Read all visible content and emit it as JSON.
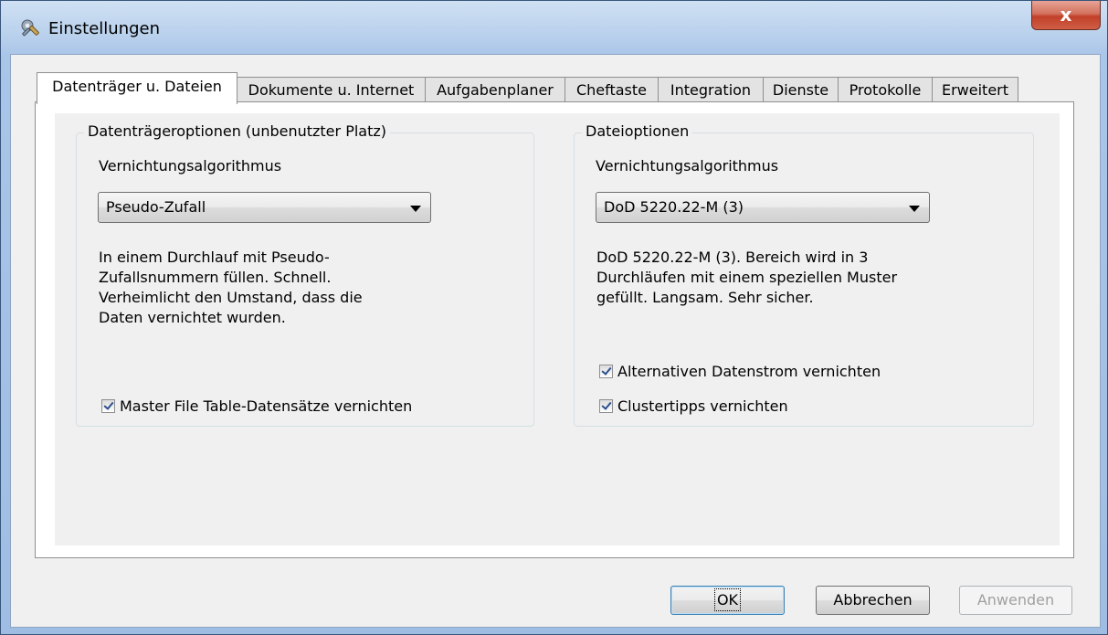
{
  "window": {
    "title": "Einstellungen",
    "close_label": "x"
  },
  "tabs": [
    {
      "label": "Datenträger u. Dateien"
    },
    {
      "label": "Dokumente u. Internet"
    },
    {
      "label": "Aufgabenplaner"
    },
    {
      "label": "Cheftaste"
    },
    {
      "label": "Integration"
    },
    {
      "label": "Dienste"
    },
    {
      "label": "Protokolle"
    },
    {
      "label": "Erweitert"
    }
  ],
  "disk_group": {
    "title": "Datenträgeroptionen (unbenutzter Platz)",
    "algo_label": "Vernichtungsalgorithmus",
    "algo_value": "Pseudo-Zufall",
    "desc_lines": [
      "In einem Durchlauf mit Pseudo-",
      "Zufallsnummern füllen. Schnell.",
      "Verheimlicht den Umstand, dass die",
      "Daten vernichtet wurden."
    ],
    "mft_checkbox": "Master File Table-Datensätze vernichten"
  },
  "file_group": {
    "title": "Dateioptionen",
    "algo_label": "Vernichtungsalgorithmus",
    "algo_value": "DoD 5220.22-M (3)",
    "desc_lines": [
      "DoD 5220.22-M (3). Bereich wird in 3",
      "Durchläufen mit einem speziellen Muster",
      "gefüllt. Langsam. Sehr sicher."
    ],
    "ads_checkbox": "Alternativen Datenstrom vernichten",
    "cluster_checkbox": "Clustertipps vernichten"
  },
  "buttons": {
    "ok": "OK",
    "cancel": "Abbrechen",
    "apply": "Anwenden"
  }
}
